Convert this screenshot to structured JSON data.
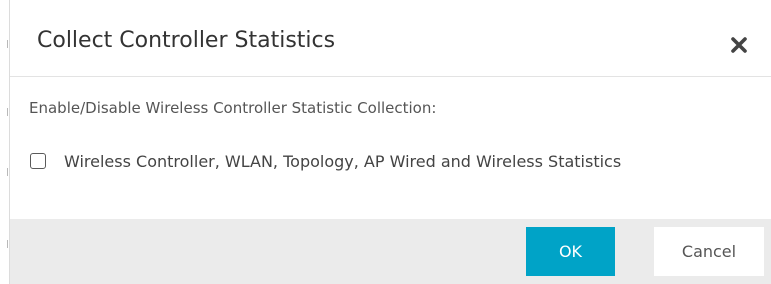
{
  "dialog": {
    "title": "Collect Controller Statistics",
    "close_icon": "close-icon"
  },
  "body": {
    "section_label": "Enable/Disable Wireless Controller Statistic Collection:",
    "option": {
      "label": "Wireless Controller, WLAN, Topology, AP Wired and Wireless Statistics",
      "checked": false
    }
  },
  "footer": {
    "ok_label": "OK",
    "cancel_label": "Cancel"
  },
  "colors": {
    "primary_button": "#00a3c7",
    "footer_background": "#ebebeb",
    "title_text": "#333333"
  }
}
